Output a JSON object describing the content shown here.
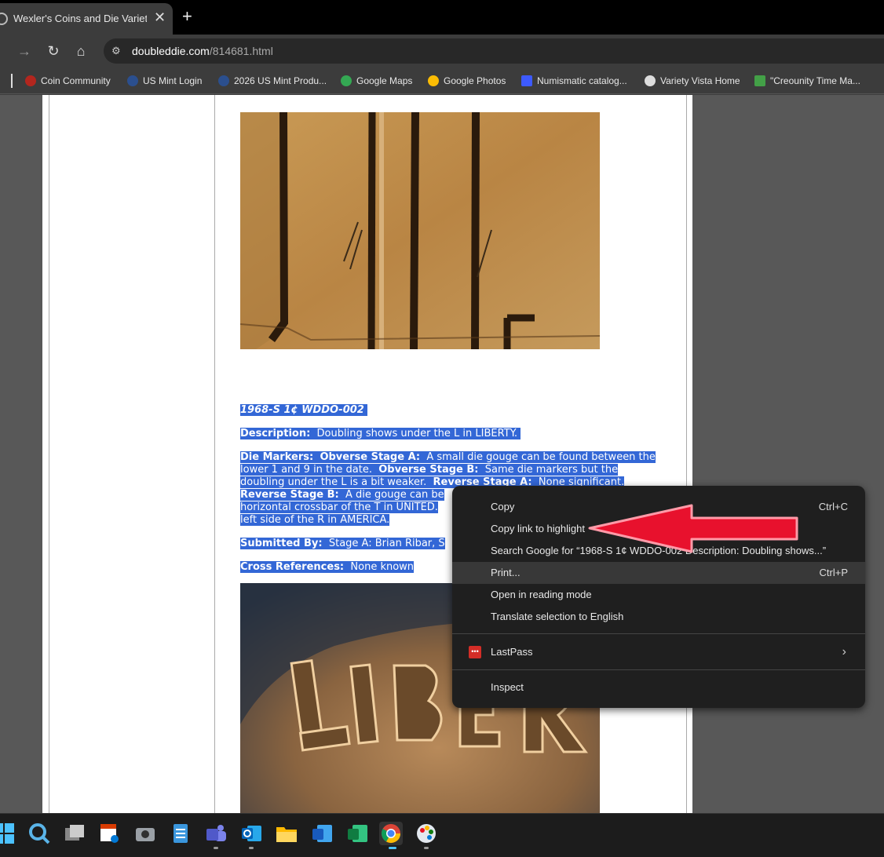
{
  "browser": {
    "tab_title": "Wexler's Coins and Die Varieties",
    "url_host": "doubleddie.com",
    "url_path": "/814681.html"
  },
  "bookmarks": [
    {
      "label": "Coin Community",
      "icon": "coin-community-icon",
      "color": "#b3261e"
    },
    {
      "label": "US Mint Login",
      "icon": "us-mint-icon",
      "color": "#2b4f8e"
    },
    {
      "label": "2026 US Mint Produ...",
      "icon": "us-mint-icon",
      "color": "#2b4f8e"
    },
    {
      "label": "Google Maps",
      "icon": "google-maps-icon",
      "color": "#34a853"
    },
    {
      "label": "Google Photos",
      "icon": "google-photos-icon",
      "color": "#fbbc04"
    },
    {
      "label": "Numismatic catalog...",
      "icon": "numista-icon",
      "color": "#3d5afe"
    },
    {
      "label": "Variety Vista Home",
      "icon": "globe-icon",
      "color": "#dddddd"
    },
    {
      "label": "\"Creounity Time Ma...",
      "icon": "clock-icon",
      "color": "#43a047"
    }
  ],
  "article": {
    "heading": "1968-S 1¢ WDDO-002",
    "description_label": "Description:",
    "description_text": "Doubling shows under the L in LIBERTY.",
    "die_markers_label": "Die Markers:",
    "obv_a_label": "Obverse Stage A:",
    "obv_a_text": "A small die gouge can be found between the lower 1 and 9 in the date.",
    "obv_b_label": "Obverse Stage B:",
    "obv_b_text": "Same die markers but the doubling under the L is a bit weaker.",
    "rev_a_label": "Reverse Stage A:",
    "rev_a_text": "None significant.",
    "rev_b_label": "Reverse Stage B:",
    "rev_b_text": "A die gouge can be",
    "rev_b_line2": "horizontal crossbar of the T in UNITED.",
    "rev_b_line3": "left side of the R in AMERICA.",
    "submitted_label": "Submitted By:",
    "submitted_text": "Stage A: Brian Ribar, S",
    "crossref_label": "Cross References:",
    "crossref_text": "None known"
  },
  "context_menu": {
    "copy": "Copy",
    "copy_shortcut": "Ctrl+C",
    "copy_link": "Copy link to highlight",
    "search_google": "Search Google for “1968-S 1¢ WDDO-002  Description:  Doubling shows...”",
    "print": "Print...",
    "print_shortcut": "Ctrl+P",
    "reading_mode": "Open in reading mode",
    "translate": "Translate selection to English",
    "lastpass": "LastPass",
    "inspect": "Inspect"
  },
  "colors": {
    "selection": "#3367d6",
    "arrow": "#e8112d",
    "menu_bg": "#1f1f1f"
  },
  "taskbar_icons": [
    "windows-start-icon",
    "search-icon",
    "task-view-icon",
    "snipping-tool-icon",
    "camera-icon",
    "notepad-icon",
    "teams-icon",
    "outlook-icon",
    "file-explorer-icon",
    "word-icon",
    "excel-icon",
    "chrome-icon",
    "paint-icon"
  ]
}
